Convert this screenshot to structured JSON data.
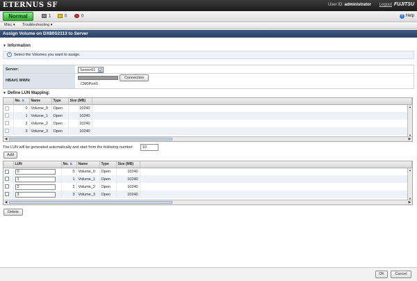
{
  "app": {
    "brand": "ETERNUS SF",
    "user_label": "User ID:",
    "user_name": "administrator",
    "logout": "Logout",
    "vendor": "FUJITSU"
  },
  "status": {
    "normal": "Normal",
    "counts": [
      "1",
      "0",
      "0"
    ],
    "help": "Help"
  },
  "menu": {
    "items": [
      "Misc ▾",
      "Troubleshooting ▾"
    ]
  },
  "page_title": "Assign Volume on DX80S2113 to Server",
  "information": {
    "title": "Information",
    "message": "Select the Volumes you want to assign."
  },
  "server": {
    "label": "Server:",
    "selected": "Server01"
  },
  "hba": {
    "label": "HBA#1 WWN:",
    "connection_button": "Connection",
    "port": "CM0Port0"
  },
  "lun_mapping": {
    "title": "Define LUN Mapping:",
    "columns": [
      "No.",
      "Name",
      "Type",
      "Size (MB)"
    ],
    "rows": [
      {
        "no": "0",
        "name": "Volume_0",
        "type": "Open",
        "size": "10240"
      },
      {
        "no": "1",
        "name": "Volume_1",
        "type": "Open",
        "size": "10240"
      },
      {
        "no": "2",
        "name": "Volume_2",
        "type": "Open",
        "size": "10240"
      },
      {
        "no": "3",
        "name": "Volume_3",
        "type": "Open",
        "size": "10240"
      }
    ],
    "auto_text": "The LUN will be generated automatically and start from the following number:",
    "start_value": "10",
    "add_button": "Add"
  },
  "assigned": {
    "columns": [
      "LUN",
      "No.",
      "Name",
      "Type",
      "Size (MB)"
    ],
    "rows": [
      {
        "lun": "0",
        "no": "0",
        "name": "Volume_0",
        "type": "Open",
        "size": "10240"
      },
      {
        "lun": "1",
        "no": "1",
        "name": "Volume_1",
        "type": "Open",
        "size": "10240"
      },
      {
        "lun": "2",
        "no": "2",
        "name": "Volume_2",
        "type": "Open",
        "size": "10240"
      },
      {
        "lun": "3",
        "no": "3",
        "name": "Volume_3",
        "type": "Open",
        "size": "10240"
      }
    ],
    "delete_button": "Delete"
  },
  "footer": {
    "ok": "OK",
    "cancel": "Cancel"
  },
  "colors": {
    "title_bar": "#2f4a72",
    "normal_status": "#3fbf3f"
  }
}
